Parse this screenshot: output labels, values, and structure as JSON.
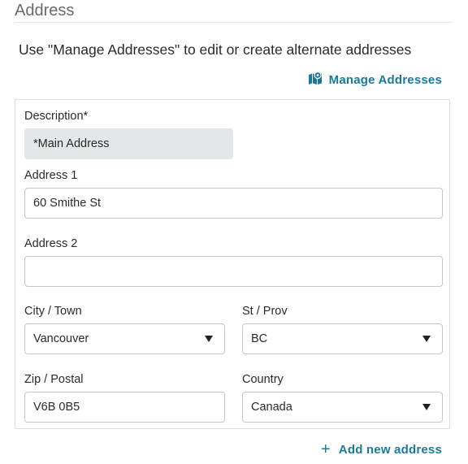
{
  "section": {
    "title": "Address",
    "hint": "Use \"Manage Addresses\" to edit or create alternate addresses"
  },
  "manage_link": {
    "label": "Manage Addresses",
    "icon": "map-icon"
  },
  "form": {
    "description": {
      "label": "Description*",
      "value": "*Main Address"
    },
    "address1": {
      "label": "Address 1",
      "value": "60 Smithe St"
    },
    "address2": {
      "label": "Address 2",
      "value": ""
    },
    "city": {
      "label": "City / Town",
      "value": "Vancouver"
    },
    "state": {
      "label": "St / Prov",
      "value": "BC"
    },
    "zip": {
      "label": "Zip / Postal",
      "value": "V6B 0B5"
    },
    "country": {
      "label": "Country",
      "value": "Canada"
    }
  },
  "add_link": {
    "label": "Add new address",
    "icon": "plus-icon"
  },
  "colors": {
    "link": "#1b7a99",
    "readonly_bg": "#e3e7e7",
    "border": "#c4c7ca"
  }
}
